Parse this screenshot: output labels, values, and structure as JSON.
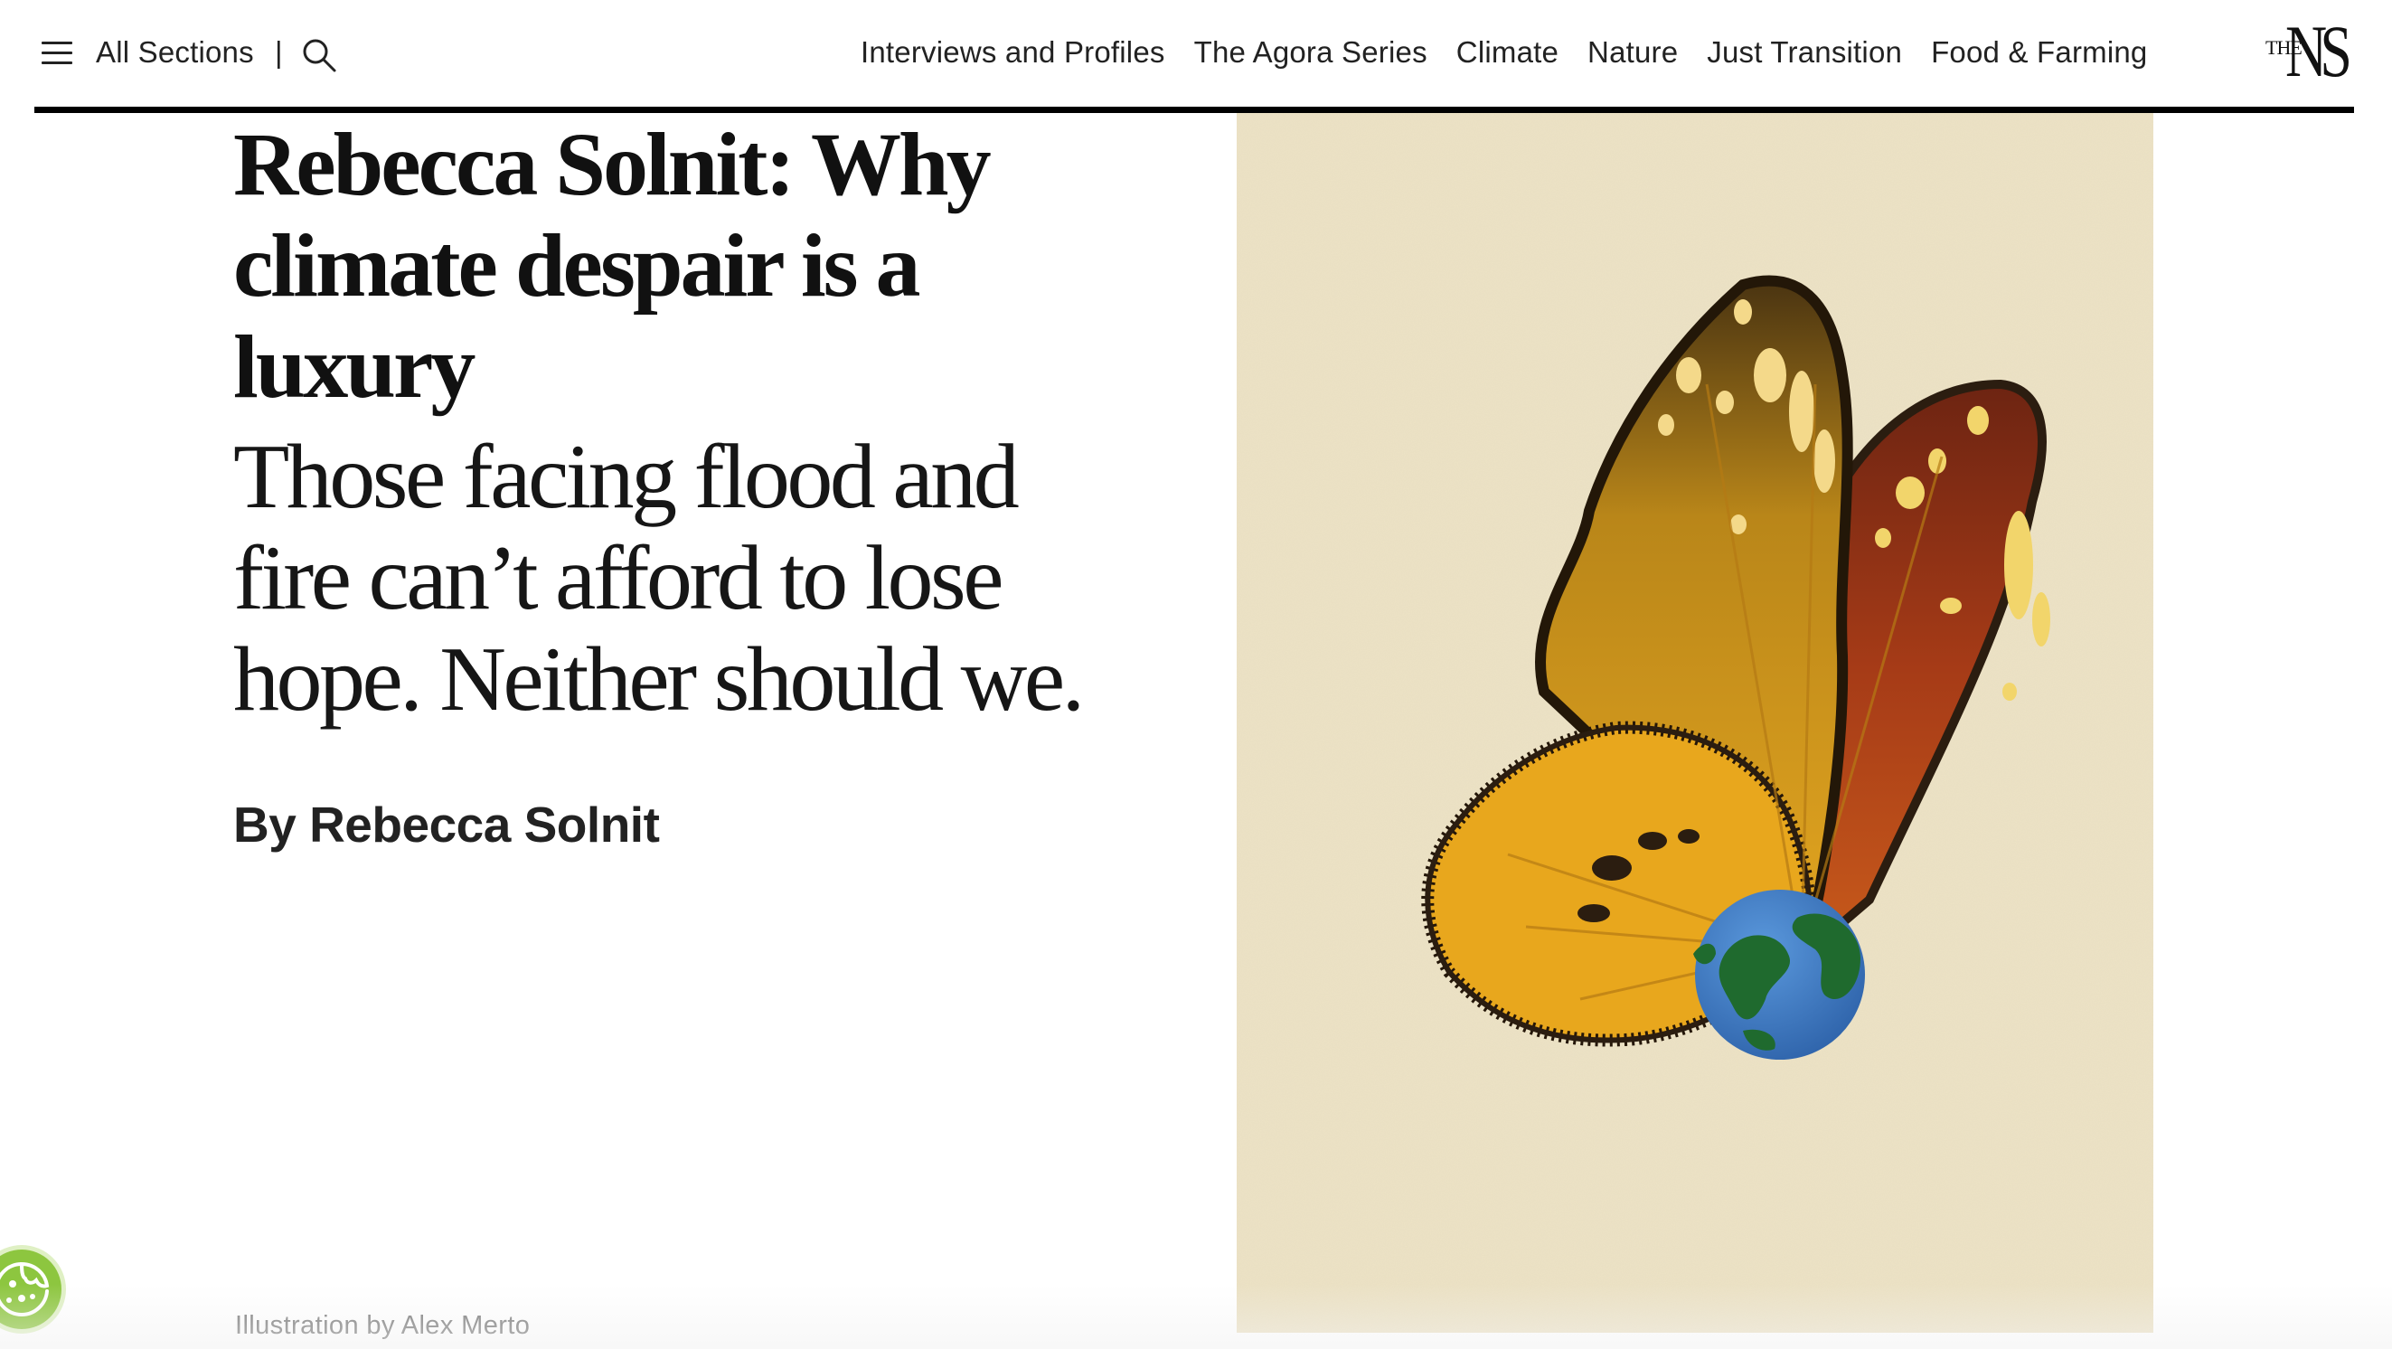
{
  "header": {
    "all_sections_label": "All Sections",
    "separator": "|",
    "nav_items": [
      "Interviews and Profiles",
      "The Agora Series",
      "Climate",
      "Nature",
      "Just Transition",
      "Food & Farming"
    ],
    "logo": {
      "the": "THE",
      "ns": "NS"
    }
  },
  "article": {
    "headline": "Rebecca Solnit: Why climate despair is a luxury",
    "standfirst": "Those facing flood and fire can’t afford to lose hope. Neither should we.",
    "byline": "By Rebecca Solnit",
    "caption": "Illustration by Alex Merto"
  },
  "illustration": {
    "subject_icons": [
      "butterfly-wing-icon",
      "globe-icon"
    ],
    "colors": {
      "background": "#ede3c6",
      "wing_yellow": "#e9a91f",
      "wing_orange": "#b9481c",
      "wing_dark": "#2b1d10",
      "globe_blue": "#3f7fc8",
      "land_green": "#1f6a2e"
    }
  },
  "cookie_button": {
    "icon": "cookie-icon",
    "color": "#8dc63f"
  }
}
